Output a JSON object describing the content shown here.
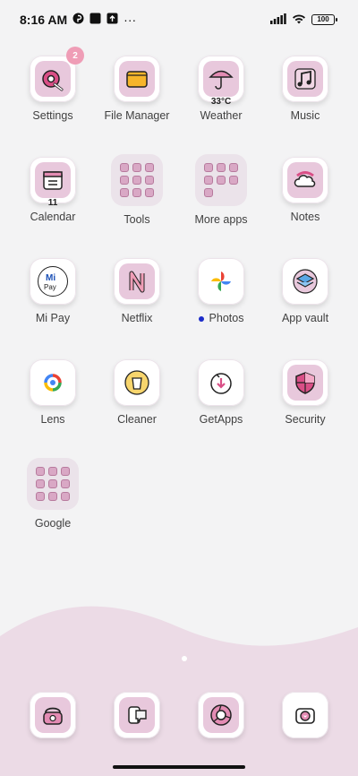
{
  "status_bar": {
    "time": "8:16 AM",
    "more": "···",
    "battery": "100"
  },
  "apps": [
    {
      "name": "settings",
      "label": "Settings",
      "icon": "settings-icon",
      "badge": "2"
    },
    {
      "name": "file-manager",
      "label": "File Manager",
      "icon": "folder-icon"
    },
    {
      "name": "weather",
      "label": "Weather",
      "icon": "umbrella-icon",
      "sub": "33°C"
    },
    {
      "name": "music",
      "label": "Music",
      "icon": "music-note-icon"
    },
    {
      "name": "calendar",
      "label": "Calendar",
      "icon": "calendar-icon",
      "sub": "11"
    },
    {
      "name": "tools",
      "label": "Tools",
      "icon": "folder-grid-icon",
      "folder": true
    },
    {
      "name": "more-apps",
      "label": "More apps",
      "icon": "folder-grid-icon",
      "folder": true
    },
    {
      "name": "notes",
      "label": "Notes",
      "icon": "cloud-note-icon"
    },
    {
      "name": "mi-pay",
      "label": "Mi Pay",
      "icon": "mi-pay-icon"
    },
    {
      "name": "netflix",
      "label": "Netflix",
      "icon": "netflix-icon"
    },
    {
      "name": "photos",
      "label": "Photos",
      "icon": "pinwheel-icon",
      "new_dot": true
    },
    {
      "name": "app-vault",
      "label": "App vault",
      "icon": "layers-icon"
    },
    {
      "name": "lens",
      "label": "Lens",
      "icon": "lens-icon"
    },
    {
      "name": "cleaner",
      "label": "Cleaner",
      "icon": "trash-bin-icon"
    },
    {
      "name": "getapps",
      "label": "GetApps",
      "icon": "download-bag-icon"
    },
    {
      "name": "security",
      "label": "Security",
      "icon": "shield-icon"
    },
    {
      "name": "google",
      "label": "Google",
      "icon": "folder-grid-icon",
      "folder": true
    }
  ],
  "dock": [
    {
      "name": "phone",
      "icon": "phone-icon"
    },
    {
      "name": "messages",
      "icon": "message-bubble-icon"
    },
    {
      "name": "browser",
      "icon": "browser-icon"
    },
    {
      "name": "camera",
      "icon": "camera-icon"
    }
  ],
  "colors": {
    "background": "#f3f3f4",
    "tile_inner": "#e8c8dc",
    "badge": "#ef9db6",
    "wave": "#ecdbe6",
    "new_dot": "#1c2cc9"
  }
}
